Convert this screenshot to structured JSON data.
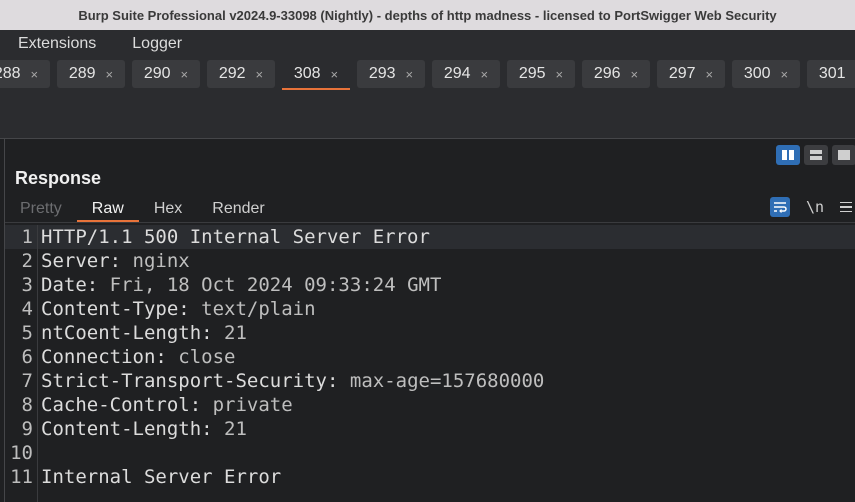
{
  "window": {
    "title": "Burp Suite Professional v2024.9-33098 (Nightly) - depths of http madness - licensed to PortSwigger Web Security"
  },
  "menubar": {
    "items": [
      {
        "label": "Extensions"
      },
      {
        "label": "Logger"
      }
    ]
  },
  "tabs": [
    {
      "label": "288",
      "close": "×"
    },
    {
      "label": "289",
      "close": "×"
    },
    {
      "label": "290",
      "close": "×"
    },
    {
      "label": "292",
      "close": "×"
    },
    {
      "label": "308",
      "close": "×",
      "active": true
    },
    {
      "label": "293",
      "close": "×"
    },
    {
      "label": "294",
      "close": "×"
    },
    {
      "label": "295",
      "close": "×"
    },
    {
      "label": "296",
      "close": "×"
    },
    {
      "label": "297",
      "close": "×"
    },
    {
      "label": "300",
      "close": "×"
    },
    {
      "label": "301",
      "close": "×"
    }
  ],
  "response": {
    "title": "Response",
    "subtabs": [
      {
        "label": "Pretty",
        "state": "disabled"
      },
      {
        "label": "Raw",
        "state": "active"
      },
      {
        "label": "Hex",
        "state": "normal"
      },
      {
        "label": "Render",
        "state": "normal"
      }
    ],
    "newline_toggle": "\\n",
    "lines": [
      {
        "n": "1",
        "name": "HTTP/1.1 500 Internal Server Error",
        "sep": "",
        "value": ""
      },
      {
        "n": "2",
        "name": "Server",
        "sep": ": ",
        "value": "nginx"
      },
      {
        "n": "3",
        "name": "Date",
        "sep": ": ",
        "value": "Fri, 18 Oct 2024 09:33:24 GMT"
      },
      {
        "n": "4",
        "name": "Content-Type",
        "sep": ": ",
        "value": "text/plain"
      },
      {
        "n": "5",
        "name": "ntCoent-Length",
        "sep": ": ",
        "value": "21"
      },
      {
        "n": "6",
        "name": "Connection",
        "sep": ": ",
        "value": "close"
      },
      {
        "n": "7",
        "name": "Strict-Transport-Security",
        "sep": ": ",
        "value": "max-age=157680000"
      },
      {
        "n": "8",
        "name": "Cache-Control",
        "sep": ": ",
        "value": "private"
      },
      {
        "n": "9",
        "name": "Content-Length",
        "sep": ": ",
        "value": "21"
      },
      {
        "n": "10",
        "name": "",
        "sep": "",
        "value": ""
      },
      {
        "n": "11",
        "name": "Internal Server Error",
        "sep": "",
        "value": ""
      }
    ]
  },
  "colors": {
    "accent": "#e8733a",
    "active_button": "#2f6eb5"
  }
}
